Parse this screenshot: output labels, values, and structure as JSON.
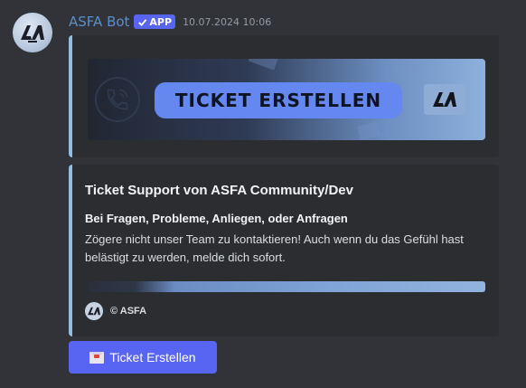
{
  "message": {
    "author": "ASFA Bot",
    "app_tag": "APP",
    "timestamp": "10.07.2024 10:06",
    "avatar_icon": "asfa-logo-icon"
  },
  "banner_embed": {
    "banner_text": "TICKET ERSTELLEN",
    "phone_icon": "phone-icon",
    "logo_icon": "asfa-logo-icon",
    "accent_color": "#8fbfe6"
  },
  "info_embed": {
    "title": "Ticket Support von ASFA Community/Dev",
    "bold_line": "Bei Fragen, Probleme, Anliegen, oder Anfragen",
    "description": "Zögere nicht unser Team zu kontaktieren! Auch wenn du das Gefühl hast belästigt zu werden, melde dich sofort.",
    "footer": "© ASFA",
    "footer_icon": "asfa-logo-icon"
  },
  "button": {
    "label": "Ticket Erstellen",
    "icon": "envelope-icon",
    "color": "#5865f2"
  }
}
